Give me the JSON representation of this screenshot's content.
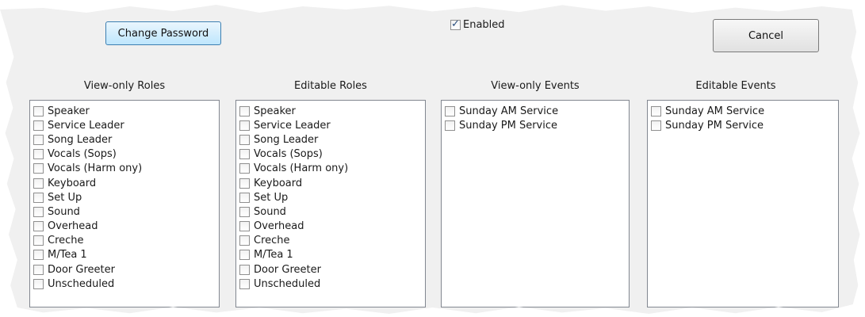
{
  "buttons": {
    "change_password": "Change Password",
    "cancel": "Cancel"
  },
  "enabled": {
    "label": "Enabled",
    "checked": true
  },
  "columns": [
    {
      "title": "View-only Roles",
      "items": [
        "Speaker",
        "Service Leader",
        "Song Leader",
        "Vocals (Sops)",
        "Vocals (Harm ony)",
        "Keyboard",
        "Set Up",
        "Sound",
        "Overhead",
        "Creche",
        "M/Tea 1",
        "Door Greeter",
        "Unscheduled"
      ]
    },
    {
      "title": "Editable Roles",
      "items": [
        "Speaker",
        "Service Leader",
        "Song Leader",
        "Vocals (Sops)",
        "Vocals (Harm ony)",
        "Keyboard",
        "Set Up",
        "Sound",
        "Overhead",
        "Creche",
        "M/Tea 1",
        "Door Greeter",
        "Unscheduled"
      ]
    },
    {
      "title": "View-only Events",
      "items": [
        "Sunday AM Service",
        "Sunday PM Service"
      ]
    },
    {
      "title": "Editable Events",
      "items": [
        "Sunday AM Service",
        "Sunday PM Service"
      ]
    }
  ]
}
